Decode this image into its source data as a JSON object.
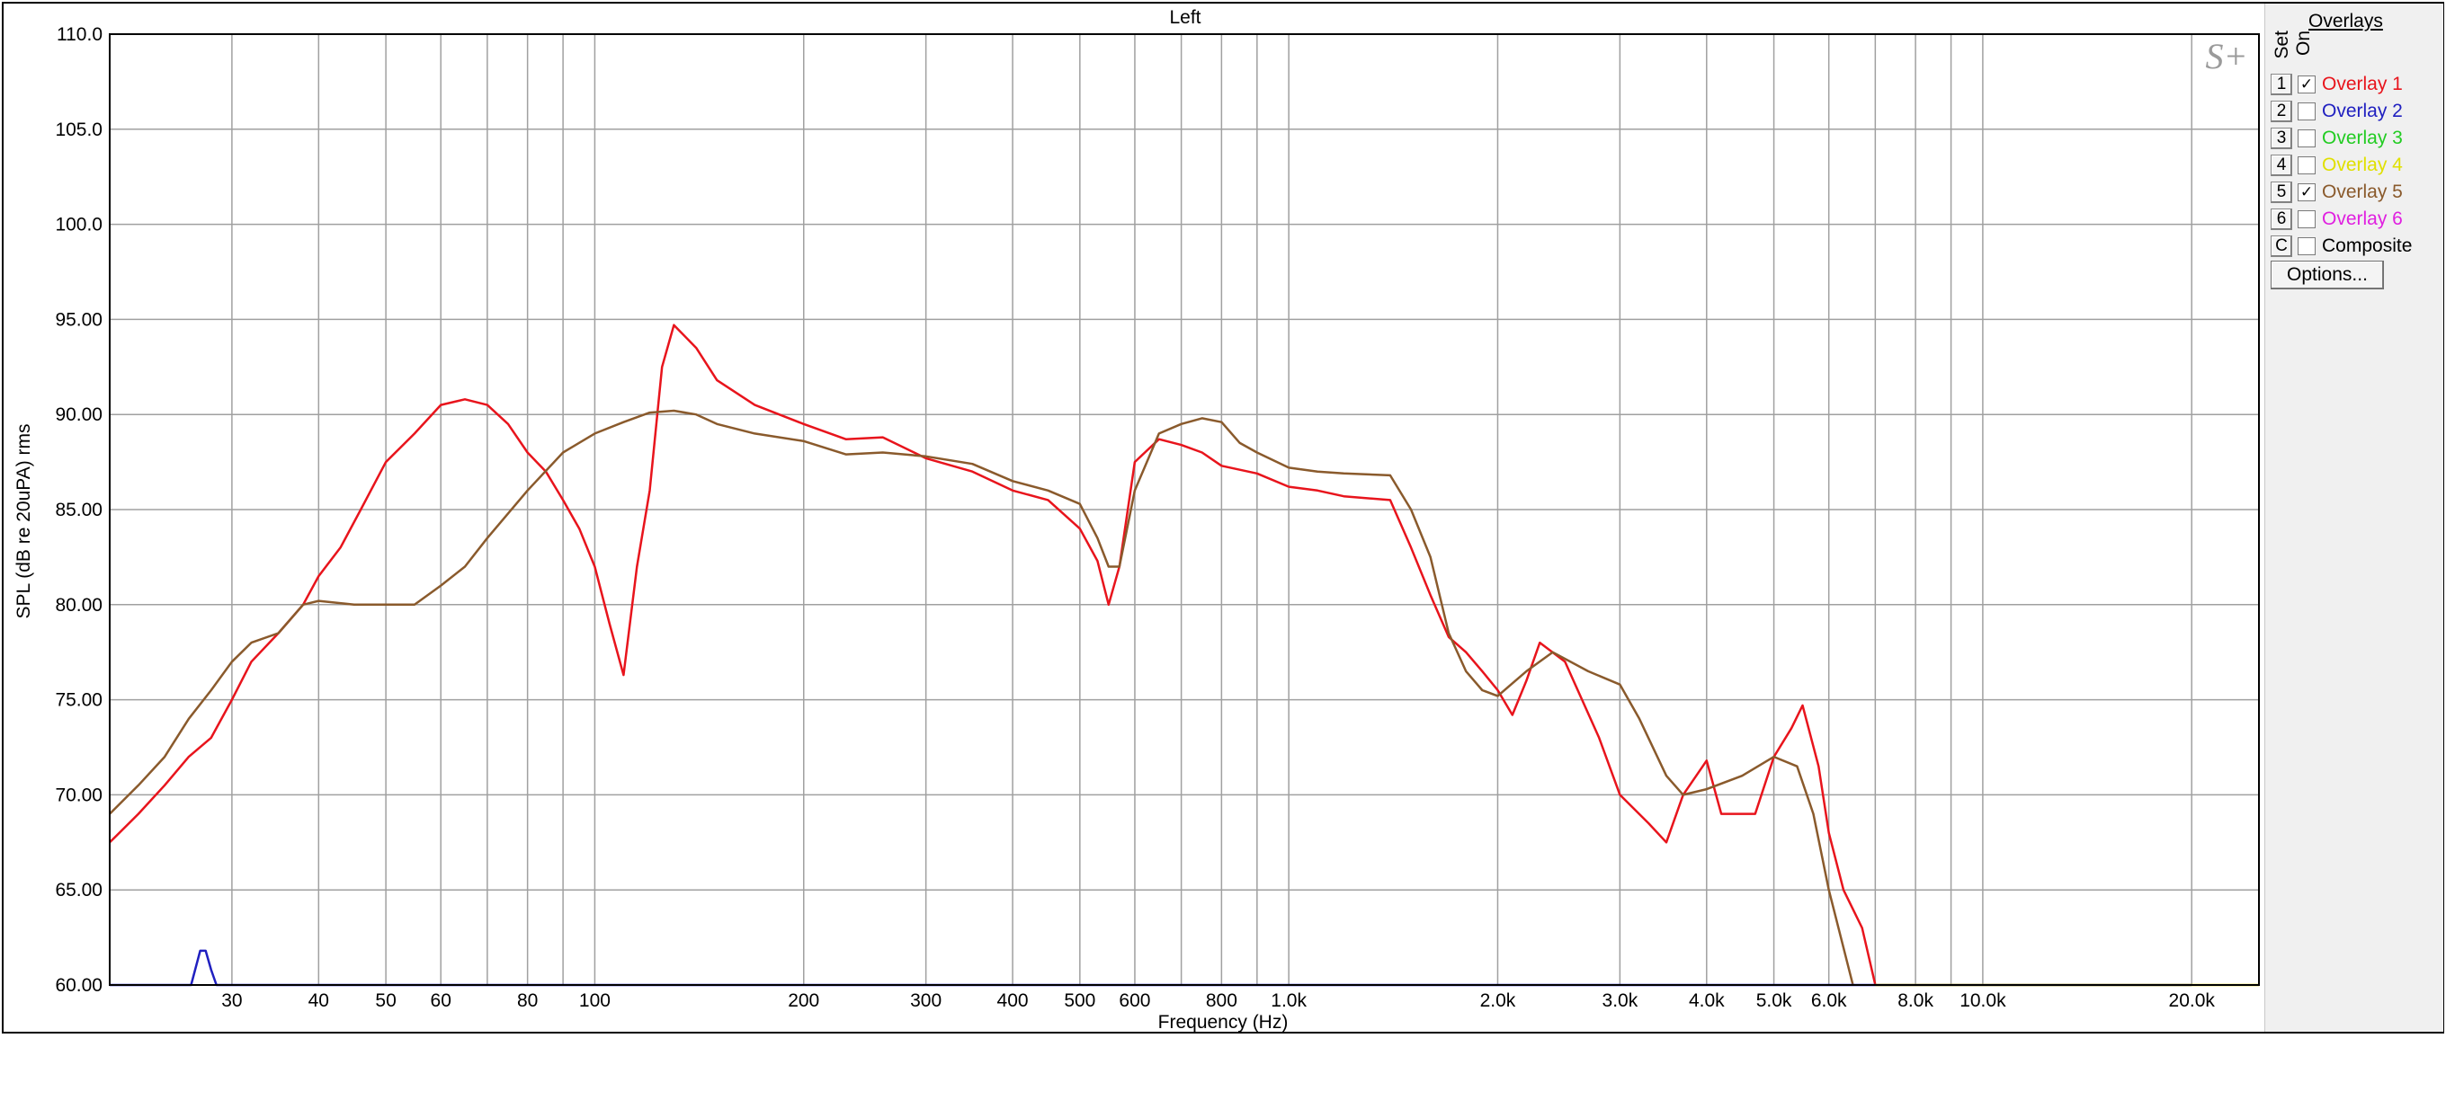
{
  "chart_data": {
    "type": "line",
    "title": "Left",
    "xlabel": "Frequency (Hz)",
    "ylabel": "SPL (dB re 20uPA) rms",
    "x_scale": "log",
    "xlim": [
      20,
      25000
    ],
    "ylim": [
      60,
      110
    ],
    "grid": true,
    "x_gridlines": [
      30,
      40,
      50,
      60,
      70,
      80,
      90,
      100,
      200,
      300,
      400,
      500,
      600,
      700,
      800,
      900,
      1000,
      2000,
      3000,
      4000,
      5000,
      6000,
      7000,
      8000,
      9000,
      10000,
      20000
    ],
    "x_ticks": [
      {
        "value": 30,
        "label": "30"
      },
      {
        "value": 40,
        "label": "40"
      },
      {
        "value": 50,
        "label": "50"
      },
      {
        "value": 60,
        "label": "60"
      },
      {
        "value": 80,
        "label": "80"
      },
      {
        "value": 100,
        "label": "100"
      },
      {
        "value": 200,
        "label": "200"
      },
      {
        "value": 300,
        "label": "300"
      },
      {
        "value": 400,
        "label": "400"
      },
      {
        "value": 500,
        "label": "500"
      },
      {
        "value": 600,
        "label": "600"
      },
      {
        "value": 800,
        "label": "800"
      },
      {
        "value": 1000,
        "label": "1.0k"
      },
      {
        "value": 2000,
        "label": "2.0k"
      },
      {
        "value": 3000,
        "label": "3.0k"
      },
      {
        "value": 4000,
        "label": "4.0k"
      },
      {
        "value": 5000,
        "label": "5.0k"
      },
      {
        "value": 6000,
        "label": "6.0k"
      },
      {
        "value": 8000,
        "label": "8.0k"
      },
      {
        "value": 10000,
        "label": "10.0k"
      },
      {
        "value": 20000,
        "label": "20.0k"
      }
    ],
    "y_ticks": [
      {
        "value": 110,
        "label": "110.0"
      },
      {
        "value": 105,
        "label": "105.0"
      },
      {
        "value": 100,
        "label": "100.0"
      },
      {
        "value": 95,
        "label": "95.00"
      },
      {
        "value": 90,
        "label": "90.00"
      },
      {
        "value": 85,
        "label": "85.00"
      },
      {
        "value": 80,
        "label": "80.00"
      },
      {
        "value": 75,
        "label": "75.00"
      },
      {
        "value": 70,
        "label": "70.00"
      },
      {
        "value": 65,
        "label": "65.00"
      },
      {
        "value": 60,
        "label": "60.00"
      }
    ],
    "series": [
      {
        "name": "Overlay 1",
        "color": "#e8141c",
        "x": [
          20,
          22,
          24,
          26,
          28,
          30,
          32,
          35,
          38,
          40,
          43,
          46,
          50,
          55,
          60,
          65,
          70,
          75,
          80,
          85,
          90,
          95,
          100,
          105,
          110,
          115,
          120,
          125,
          130,
          140,
          150,
          170,
          200,
          230,
          260,
          300,
          350,
          400,
          450,
          500,
          530,
          550,
          570,
          600,
          650,
          700,
          750,
          800,
          900,
          1000,
          1100,
          1200,
          1400,
          1500,
          1600,
          1700,
          1800,
          1900,
          2000,
          2100,
          2200,
          2300,
          2500,
          2800,
          3000,
          3300,
          3500,
          3700,
          4000,
          4200,
          4400,
          4700,
          5000,
          5300,
          5500,
          5800,
          6000,
          6300,
          6700,
          7000
        ],
        "y": [
          67.5,
          69,
          70.5,
          72,
          73,
          75,
          77,
          78.5,
          80,
          81.5,
          83,
          85,
          87.5,
          89,
          90.5,
          90.8,
          90.5,
          89.5,
          88,
          87,
          85.5,
          84,
          82,
          79,
          76.3,
          82,
          86,
          92.5,
          94.7,
          93.5,
          91.8,
          90.5,
          89.5,
          88.7,
          88.8,
          87.7,
          87,
          86,
          85.5,
          84,
          82.3,
          80,
          82,
          87.5,
          88.7,
          88.4,
          88,
          87.3,
          86.9,
          86.2,
          86,
          85.7,
          85.5,
          83,
          80.5,
          78.3,
          77.5,
          76.5,
          75.5,
          74.2,
          76,
          78,
          77,
          73,
          70,
          68.5,
          67.5,
          70,
          71.8,
          69,
          69,
          69,
          72,
          73.5,
          74.7,
          71.5,
          68,
          65,
          63,
          60
        ]
      },
      {
        "name": "Overlay 5",
        "color": "#8a5a2c",
        "x": [
          20,
          22,
          24,
          26,
          28,
          30,
          32,
          35,
          38,
          40,
          45,
          50,
          55,
          60,
          65,
          70,
          80,
          90,
          100,
          110,
          120,
          130,
          140,
          150,
          170,
          200,
          230,
          260,
          300,
          350,
          400,
          450,
          500,
          530,
          550,
          570,
          600,
          650,
          700,
          750,
          800,
          850,
          900,
          1000,
          1100,
          1200,
          1400,
          1500,
          1600,
          1700,
          1800,
          1900,
          2000,
          2200,
          2400,
          2700,
          3000,
          3200,
          3500,
          3700,
          4000,
          4500,
          5000,
          5400,
          5700,
          6000,
          6500
        ],
        "y": [
          69,
          70.5,
          72,
          74,
          75.5,
          77,
          78,
          78.5,
          80,
          80.2,
          80,
          80,
          80,
          81,
          82,
          83.5,
          86,
          88,
          89,
          89.6,
          90.1,
          90.2,
          90,
          89.5,
          89,
          88.6,
          87.9,
          88,
          87.8,
          87.4,
          86.5,
          86,
          85.3,
          83.5,
          82,
          82,
          86,
          89,
          89.5,
          89.8,
          89.6,
          88.5,
          88,
          87.2,
          87,
          86.9,
          86.8,
          85,
          82.5,
          78.5,
          76.5,
          75.5,
          75.2,
          76.5,
          77.5,
          76.5,
          75.8,
          74,
          71,
          70,
          70.3,
          71,
          72,
          71.5,
          69,
          65,
          60
        ]
      },
      {
        "name": "Overlay 2",
        "color": "#2020c0",
        "x": [
          20,
          25,
          26.2,
          27,
          27.5,
          28,
          28.5,
          30,
          40,
          100,
          1000,
          10000,
          20000
        ],
        "y": [
          60,
          60,
          60,
          61.8,
          61.8,
          60.8,
          60,
          60,
          60,
          60,
          60,
          60,
          60
        ]
      },
      {
        "name": "Overlay 4",
        "color": "#d8c800",
        "x": [
          7000,
          10000,
          20000,
          25000
        ],
        "y": [
          60,
          60,
          60,
          60
        ]
      }
    ]
  },
  "panel": {
    "title": "Overlays",
    "set_header": "Set",
    "on_header": "On",
    "options_label": "Options...",
    "items": [
      {
        "key": "1",
        "label": "Overlay 1",
        "color": "#e8141c",
        "checked": "✓"
      },
      {
        "key": "2",
        "label": "Overlay 2",
        "color": "#2020c0",
        "checked": ""
      },
      {
        "key": "3",
        "label": "Overlay 3",
        "color": "#22cc22",
        "checked": ""
      },
      {
        "key": "4",
        "label": "Overlay 4",
        "color": "#e0e000",
        "checked": ""
      },
      {
        "key": "5",
        "label": "Overlay 5",
        "color": "#8a5a2c",
        "checked": "✓"
      },
      {
        "key": "6",
        "label": "Overlay 6",
        "color": "#e020e0",
        "checked": ""
      },
      {
        "key": "C",
        "label": "Composite",
        "color": "#000000",
        "checked": ""
      }
    ]
  },
  "watermark": "S+"
}
